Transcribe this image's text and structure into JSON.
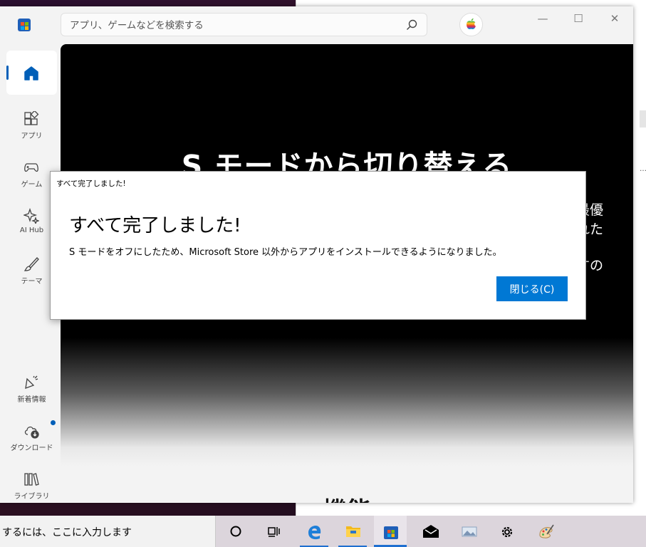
{
  "store": {
    "search_placeholder": "アプリ、ゲームなどを検索する",
    "window_controls": {
      "minimize": "—",
      "maximize": "☐",
      "close": "✕"
    },
    "sidebar": {
      "items": [
        {
          "label": "",
          "icon": "home-icon",
          "selected": true
        },
        {
          "label": "アプリ",
          "icon": "apps-icon"
        },
        {
          "label": "ゲーム",
          "icon": "gamepad-icon"
        },
        {
          "label": "AI Hub",
          "icon": "sparkle-icon"
        },
        {
          "label": "テーマ",
          "icon": "brush-icon"
        },
        {
          "label": "新着情報",
          "icon": "megaphone-icon"
        },
        {
          "label": "ダウンロード",
          "icon": "download-cloud-icon",
          "badge": true
        },
        {
          "label": "ライブラリ",
          "icon": "library-icon"
        }
      ]
    },
    "hero": {
      "title": "S モードから切り替える",
      "right_fragments": [
        "最優",
        "れた",
        "すの"
      ]
    },
    "section_title": "機能"
  },
  "dialog": {
    "caption": "すべて完了しました!",
    "heading": "すべて完了しました!",
    "message": "S モードをオフにしたため、Microsoft Store 以外からアプリをインストールできるようになりました。",
    "close_label": "閉じる(C)"
  },
  "taskbar": {
    "search_text": "するには、ここに入力します",
    "icons": [
      "cortana-circle-icon",
      "task-view-icon",
      "edge-icon",
      "file-explorer-icon",
      "store-icon",
      "mail-icon",
      "photos-icon",
      "settings-icon",
      "paint-icon"
    ]
  },
  "colors": {
    "accent": "#0078d4",
    "nav_accent": "#005fb8"
  }
}
